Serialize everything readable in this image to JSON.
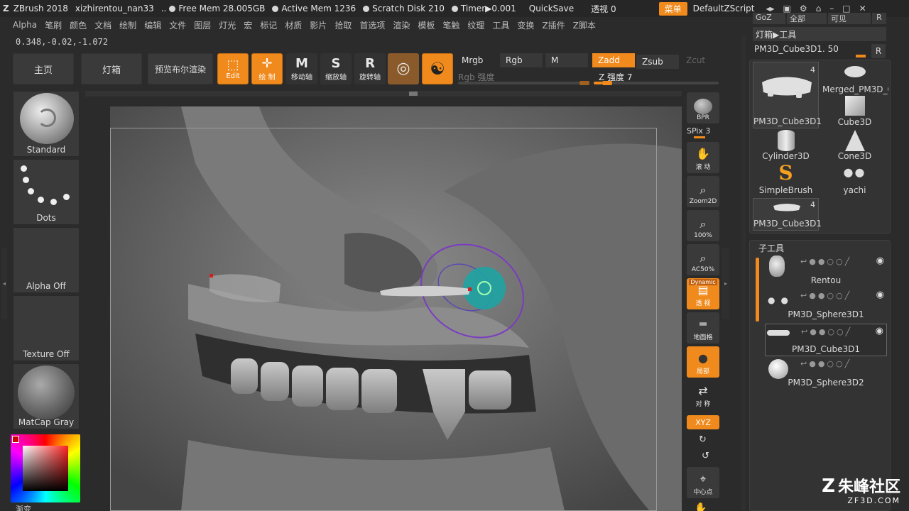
{
  "title_bar": {
    "app": "ZBrush 2018",
    "project": "xizhirentou_nan33",
    "ellipsis": "..",
    "free_mem": "Free Mem 28.005GB",
    "active_mem": "Active Mem 1236",
    "scratch_disk": "Scratch Disk 210",
    "timer": "Timer▶0.001",
    "quicksave": "QuickSave",
    "transparency": "透视  0",
    "menu_button": "菜单",
    "script_name": "DefaultZScript"
  },
  "menu": [
    "Alpha",
    "笔刷",
    "颜色",
    "文档",
    "绘制",
    "编辑",
    "文件",
    "图层",
    "灯光",
    "宏",
    "标记",
    "材质",
    "影片",
    "拾取",
    "首选项",
    "渲染",
    "模板",
    "笔触",
    "纹理",
    "工具",
    "变换",
    "Z插件",
    "Z脚本"
  ],
  "coords": "0.348,-0.02,-1.072",
  "shelf": {
    "home": "主页",
    "lightbox": "灯箱",
    "bpr_preview": "预览布尔渲染",
    "edit": "Edit",
    "draw": "绘 制",
    "move": "移动轴",
    "scale": "缩放轴",
    "rotate": "旋转轴",
    "mrgb": "Mrgb",
    "rgb": "Rgb",
    "m": "M",
    "zadd": "Zadd",
    "zsub": "Zsub",
    "zcut": "Zcut",
    "rgb_intensity": "Rgb 强度",
    "z_intensity": "Z 强度 7",
    "z_intensity_value": 7
  },
  "left_panel": {
    "brush": "Standard",
    "stroke": "Dots",
    "alpha": "Alpha Off",
    "texture": "Texture Off",
    "material": "MatCap Gray",
    "gradient": "渐变"
  },
  "dock": {
    "bpr": "BPR",
    "spix": "SPix 3",
    "scroll": "滚 动",
    "zoom2d": "Zoom2D",
    "zoom100": "100%",
    "ac50": "AC50%",
    "dynamic": "Dynamic",
    "perspective": "透 视",
    "floor": "地面格",
    "solo": "局部",
    "symmetry": "对 称",
    "xyz": "XYZ",
    "center": "中心点"
  },
  "right_panel": {
    "top_tabs": [
      "GoZ",
      "全部",
      "可见",
      "R"
    ],
    "lightbox_tools": "灯箱▶工具",
    "current_tool": "PM3D_Cube3D1. 50",
    "r_button": "R",
    "tools": [
      {
        "name": "PM3D_Cube3D1",
        "count": "4"
      },
      {
        "name": "Merged_PM3D_C"
      },
      {
        "name": "Cube3D"
      },
      {
        "name": "Cylinder3D"
      },
      {
        "name": "Cone3D"
      },
      {
        "name": "SimpleBrush"
      },
      {
        "name": "yachi"
      },
      {
        "name": "PM3D_Cube3D1",
        "count": "4"
      }
    ],
    "subtool_title": "子工具",
    "subtools": [
      "Rentou",
      "PM3D_Sphere3D1",
      "PM3D_Cube3D1",
      "PM3D_Sphere3D2"
    ]
  },
  "watermark": {
    "name": "朱峰社区",
    "url": "ZF3D.COM"
  }
}
